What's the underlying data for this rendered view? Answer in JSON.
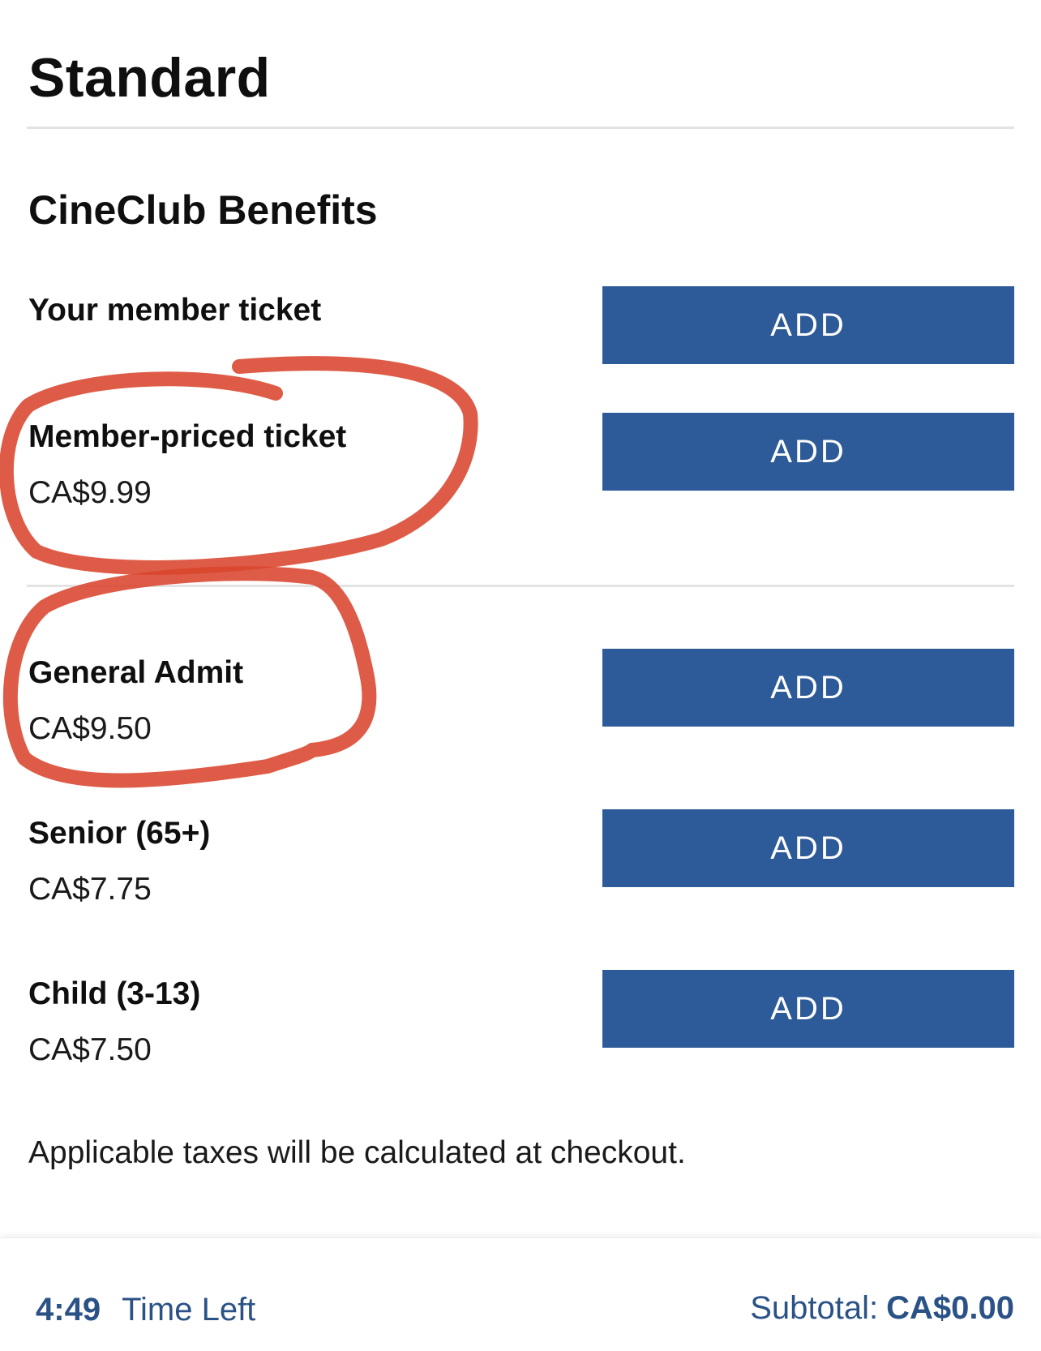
{
  "page": {
    "title": "Standard"
  },
  "section": {
    "title": "CineClub Benefits"
  },
  "tickets": [
    {
      "name": "Your member ticket",
      "price": "",
      "button": "ADD"
    },
    {
      "name": "Member-priced ticket",
      "price": "CA$9.99",
      "button": "ADD"
    },
    {
      "name": "General Admit",
      "price": "CA$9.50",
      "button": "ADD"
    },
    {
      "name": "Senior (65+)",
      "price": "CA$7.75",
      "button": "ADD"
    },
    {
      "name": "Child (3-13)",
      "price": "CA$7.50",
      "button": "ADD"
    }
  ],
  "taxes_note": "Applicable taxes will be calculated at checkout.",
  "footer": {
    "timer_value": "4:49",
    "timer_label": "Time Left",
    "subtotal_label": "Subtotal:",
    "subtotal_amount": "CA$0.00"
  },
  "colors": {
    "button_bg": "#2d5a98",
    "footer_text": "#2b5287",
    "annotation": "#d9462e"
  }
}
